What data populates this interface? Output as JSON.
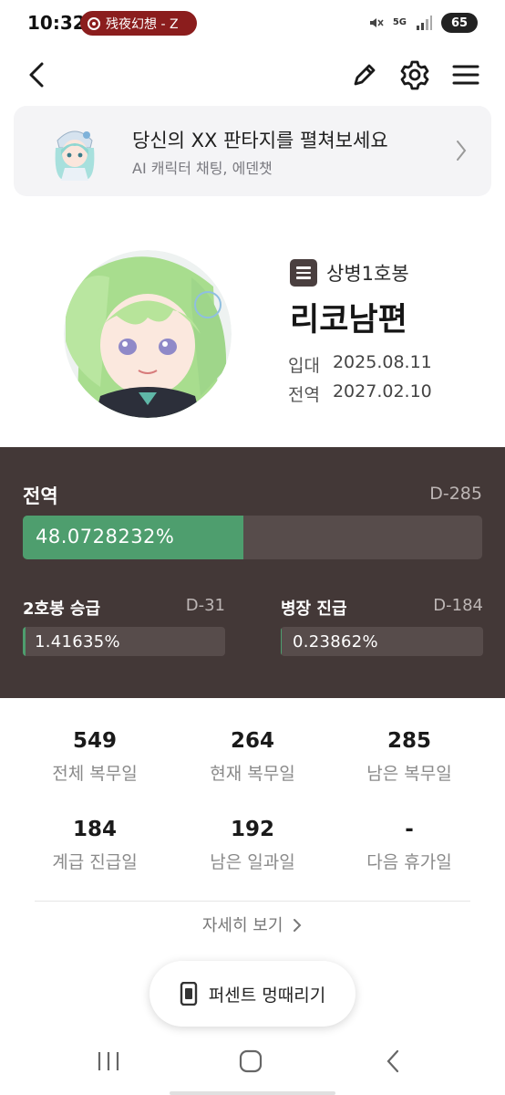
{
  "status_bar": {
    "time": "10:32",
    "recording_text": "残夜幻想 - Z",
    "network": "5G",
    "battery": "65"
  },
  "header": {
    "back_icon": "chevron-left-icon",
    "edit_icon": "pencil-icon",
    "settings_icon": "gear-icon",
    "menu_icon": "hamburger-icon"
  },
  "banner": {
    "title": "당신의 XX 판타지를 펼쳐보세요",
    "subtitle": "AI 캐릭터 채팅, 에덴챗"
  },
  "profile": {
    "rank": "상병1호봉",
    "name": "리코남편",
    "enlist_label": "입대",
    "enlist_date": "2025.08.11",
    "discharge_label": "전역",
    "discharge_date": "2027.02.10"
  },
  "progress": {
    "main": {
      "title": "전역",
      "dday": "D-285",
      "percent_text": "48.0728232%",
      "fraction": 0.480728232
    },
    "promotion_hobong": {
      "title": "2호봉 승급",
      "dday": "D-31",
      "percent_text": "1.41635%",
      "fraction": 0.0141635
    },
    "promotion_rank": {
      "title": "병장 진급",
      "dday": "D-184",
      "percent_text": "0.23862%",
      "fraction": 0.0023862
    }
  },
  "stats": [
    {
      "value": "549",
      "label": "전체 복무일"
    },
    {
      "value": "264",
      "label": "현재 복무일"
    },
    {
      "value": "285",
      "label": "남은 복무일"
    },
    {
      "value": "184",
      "label": "계급 진급일"
    },
    {
      "value": "192",
      "label": "남은 일과일"
    },
    {
      "value": "-",
      "label": "다음 휴가일"
    }
  ],
  "more_link": "자세히 보기",
  "percent_button": "퍼센트 멍때리기",
  "colors": {
    "panel_bg": "#433837",
    "progress_green": "#4e9e6e",
    "banner_bg": "#f4f4f6"
  }
}
